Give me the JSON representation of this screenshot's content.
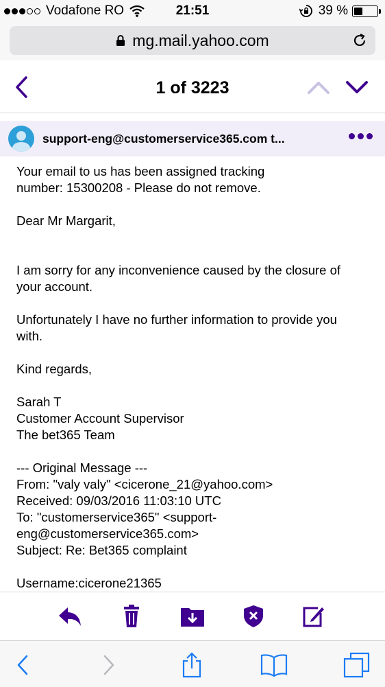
{
  "status_bar": {
    "carrier": "Vodafone RO",
    "time": "21:51",
    "battery_percent": "39 %",
    "battery_level": 0.39,
    "signal_bars": 3,
    "signal_total": 5
  },
  "browser": {
    "url": "mg.mail.yahoo.com",
    "icons": [
      "lock-icon",
      "reload-icon"
    ]
  },
  "mail_header": {
    "position_text": "1 of 3223"
  },
  "sender": {
    "display": "support-eng@customerservice365.com t..."
  },
  "email_body": {
    "tracking_line1": "Your email to us has been assigned tracking",
    "tracking_line2": "number: 15300208 - Please do not remove.",
    "greeting": "Dear Mr Margarit,",
    "para1_line1": "I am sorry for any inconvenience caused by the closure of",
    "para1_line2": "your account.",
    "para2_line1": "Unfortunately I have no further information to provide you",
    "para2_line2": "with.",
    "closing": "Kind regards,",
    "sig_name": "Sarah T",
    "sig_title": "Customer Account Supervisor",
    "sig_team": "The bet365 Team",
    "orig_header": "--- Original Message ---",
    "orig_from": "From: \"valy valy\" <cicerone_21@yahoo.com>",
    "orig_received": "Received: 09/03/2016 11:03:10 UTC",
    "orig_to_line1": "To: \"customerservice365\" <support-",
    "orig_to_line2": "eng@customerservice365.com>",
    "orig_subject": "Subject: Re: Bet365 complaint",
    "username": "Username:cicerone21365"
  },
  "colors": {
    "accent": "#400090",
    "accent_light": "#c9c1e3",
    "ios_blue": "#1a7cf5",
    "sender_bg": "#f1eefa"
  }
}
